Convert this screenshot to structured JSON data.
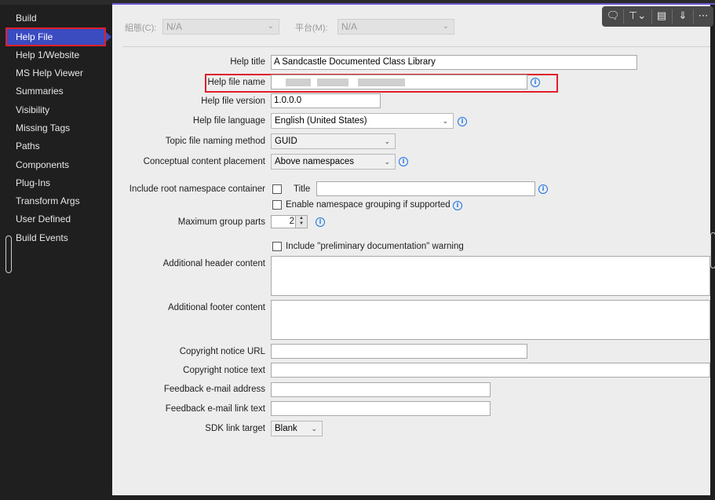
{
  "sidebar": {
    "items": [
      {
        "label": "Build"
      },
      {
        "label": "Help File"
      },
      {
        "label": "Help 1/Website"
      },
      {
        "label": "MS Help Viewer"
      },
      {
        "label": "Summaries"
      },
      {
        "label": "Visibility"
      },
      {
        "label": "Missing Tags"
      },
      {
        "label": "Paths"
      },
      {
        "label": "Components"
      },
      {
        "label": "Plug-Ins"
      },
      {
        "label": "Transform Args"
      },
      {
        "label": "User Defined"
      },
      {
        "label": "Build Events"
      }
    ],
    "active_index": 1
  },
  "filterbar": {
    "config_label": "組態(C):",
    "config_value": "N/A",
    "platform_label": "平台(M):",
    "platform_value": "N/A"
  },
  "form": {
    "help_title": {
      "label": "Help title",
      "value": "A Sandcastle Documented Class Library"
    },
    "help_file_name": {
      "label": "Help file name",
      "value": ""
    },
    "help_file_version": {
      "label": "Help file version",
      "value": "1.0.0.0"
    },
    "help_file_language": {
      "label": "Help file language",
      "value": "English (United States)"
    },
    "topic_naming": {
      "label": "Topic file naming method",
      "value": "GUID"
    },
    "conceptual_placement": {
      "label": "Conceptual content placement",
      "value": "Above namespaces"
    },
    "include_root_ns": {
      "label": "Include root namespace container",
      "title_label": "Title",
      "title_value": "",
      "checked": false
    },
    "namespace_grouping": {
      "label": "Enable namespace grouping if supported",
      "checked": false
    },
    "max_group_parts": {
      "label": "Maximum group parts",
      "value": "2"
    },
    "preliminary": {
      "label": "Include \"preliminary documentation\" warning",
      "checked": false
    },
    "header_content": {
      "label": "Additional header content",
      "value": ""
    },
    "footer_content": {
      "label": "Additional footer content",
      "value": ""
    },
    "copyright_url": {
      "label": "Copyright notice URL",
      "value": ""
    },
    "copyright_text": {
      "label": "Copyright notice text",
      "value": ""
    },
    "feedback_email": {
      "label": "Feedback e-mail address",
      "value": ""
    },
    "feedback_link_text": {
      "label": "Feedback e-mail link text",
      "value": ""
    },
    "sdk_link_target": {
      "label": "SDK link target",
      "value": "Blank"
    }
  },
  "icons": {
    "info": "info-icon",
    "chevron": "chevron-down-icon"
  },
  "colors": {
    "sidebar_bg": "#1f1f1f",
    "active_item": "#3b4bc0",
    "highlight": "#e0202a",
    "info_blue": "#1a73e8",
    "panel_bg": "#ededed"
  }
}
